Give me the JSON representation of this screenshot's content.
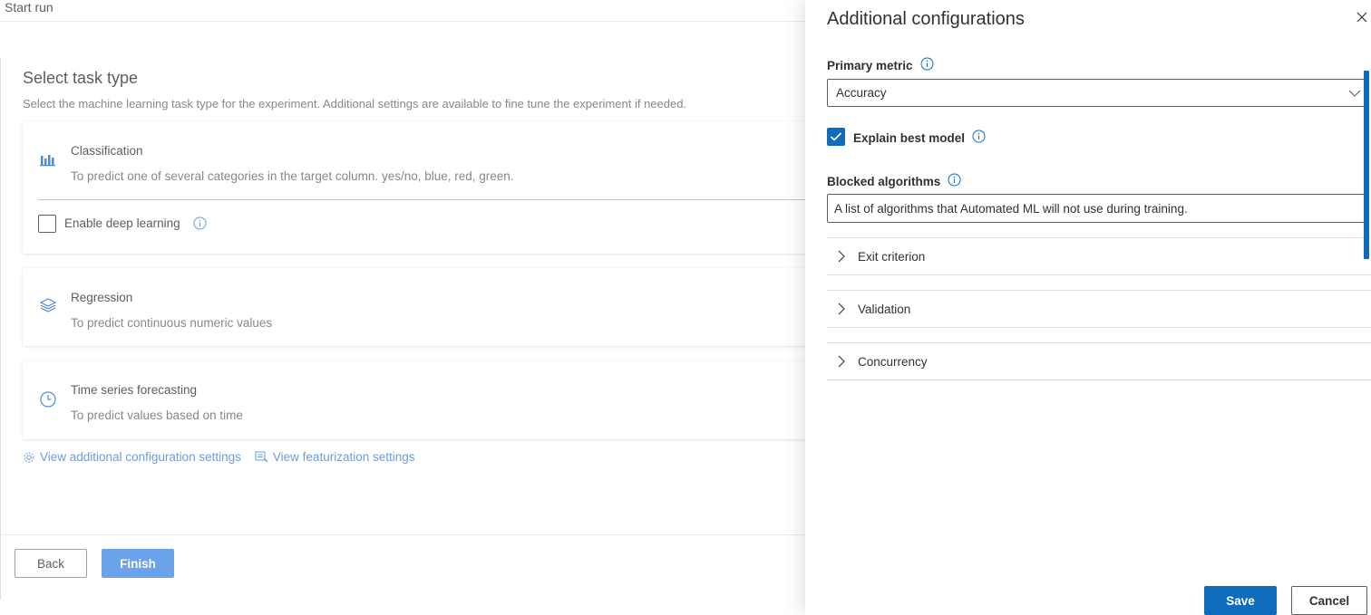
{
  "page": {
    "title": "Start run",
    "heading": "Select task type",
    "description": "Select the machine learning task type for the experiment. Additional settings are available to fine tune the experiment if needed."
  },
  "tasks": [
    {
      "title": "Classification",
      "subtitle": "To predict one of several categories in the target column. yes/no, blue, red, green.",
      "icon": "bar-chart-icon"
    },
    {
      "title": "Regression",
      "subtitle": "To predict continuous numeric values",
      "icon": "layers-icon"
    },
    {
      "title": "Time series forecasting",
      "subtitle": "To predict values based on time",
      "icon": "clock-icon"
    }
  ],
  "deep_learning": {
    "label": "Enable deep learning",
    "checked": false
  },
  "links": {
    "additional_config": "View additional configuration settings",
    "featurization": "View featurization settings"
  },
  "footer": {
    "back": "Back",
    "finish": "Finish"
  },
  "panel": {
    "title": "Additional configurations",
    "primary_metric": {
      "label": "Primary metric",
      "value": "Accuracy"
    },
    "explain_best_model": {
      "label": "Explain best model",
      "checked": true
    },
    "blocked_algorithms": {
      "label": "Blocked algorithms",
      "value": "A list of algorithms that Automated ML will not use during training."
    },
    "sections": [
      "Exit criterion",
      "Validation",
      "Concurrency"
    ],
    "save": "Save",
    "cancel": "Cancel"
  },
  "colors": {
    "accent": "#0f6cbd",
    "link": "#6f9bd8",
    "finish_disabled": "#6aa3ec"
  }
}
